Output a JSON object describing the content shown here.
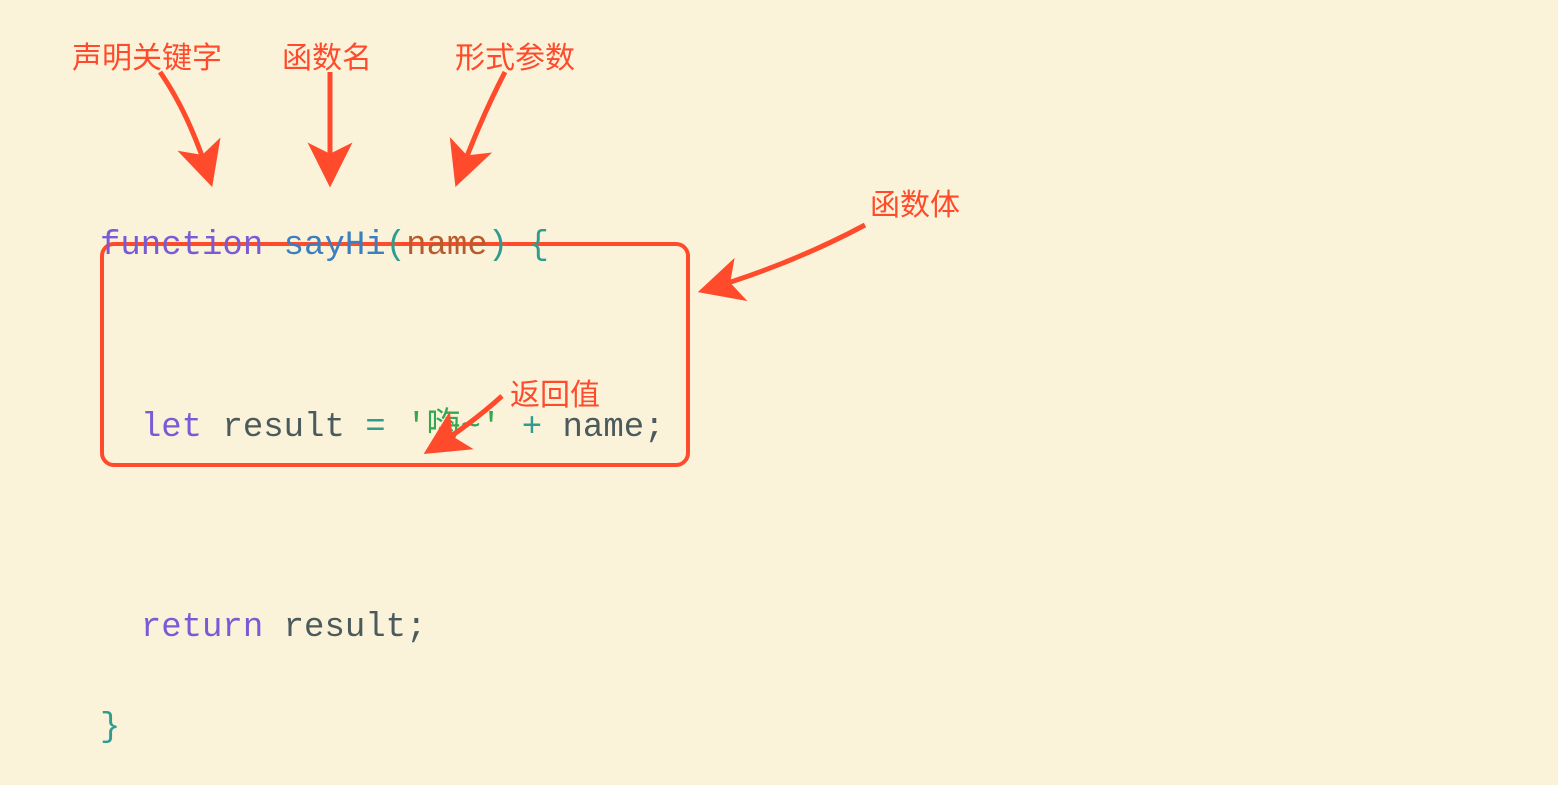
{
  "labels": {
    "keyword": "声明关键字",
    "funcname": "函数名",
    "param": "形式参数",
    "body": "函数体",
    "return": "返回值"
  },
  "code": {
    "kw_function": "function",
    "fn_name": "sayHi",
    "paren_open": "(",
    "param": "name",
    "paren_close": ")",
    "brace_open": "{",
    "kw_let": "let",
    "var_result": "result",
    "eq": "=",
    "str_hi": "'嗨~'",
    "plus": "+",
    "kw_return": "return",
    "semi": ";",
    "brace_close": "}"
  }
}
